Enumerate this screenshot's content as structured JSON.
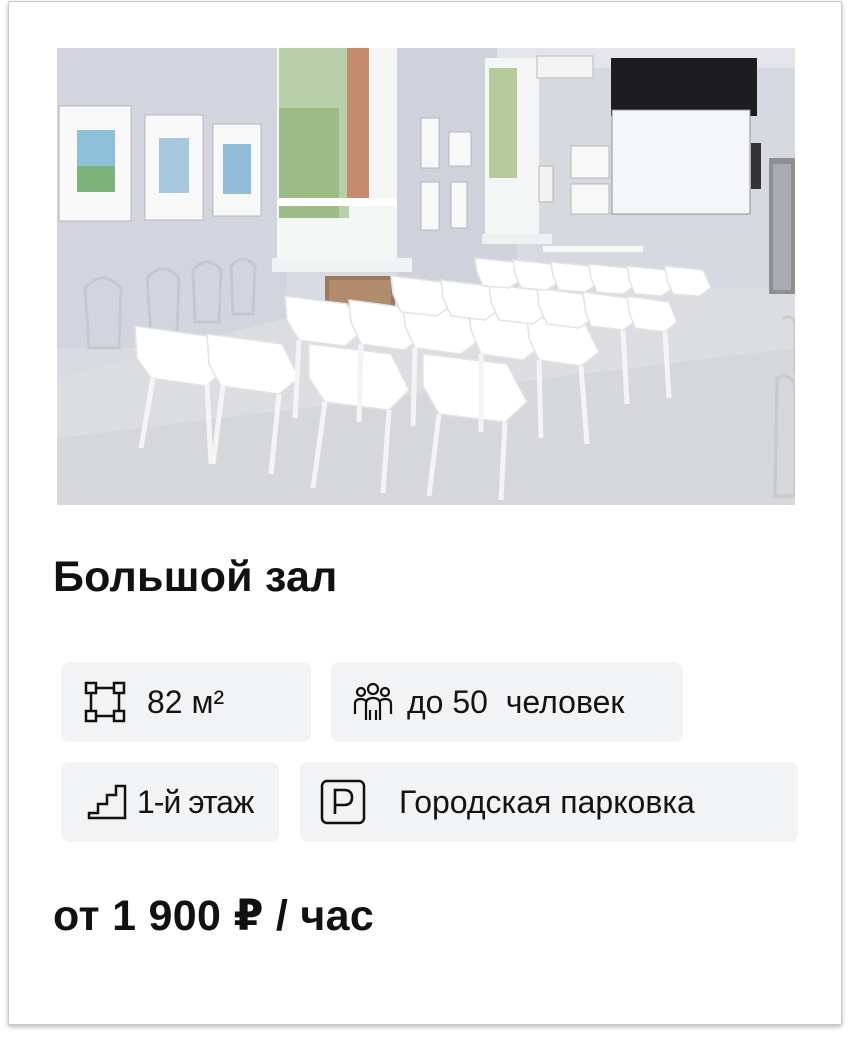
{
  "venue": {
    "title": "Большой зал",
    "features": [
      {
        "icon": "area-icon",
        "label": "82 м²"
      },
      {
        "icon": "people-icon",
        "label": "до 50  человек"
      },
      {
        "icon": "stairs-icon",
        "label": "1-й этаж"
      },
      {
        "icon": "parking-icon",
        "label": "Городская парковка"
      }
    ],
    "price": "от 1 900 ₽ / час",
    "photo_icon": "room-photo"
  },
  "colors": {
    "chip_bg": "#f2f3f5",
    "text": "#111111",
    "card_border": "#c9c9cc"
  }
}
